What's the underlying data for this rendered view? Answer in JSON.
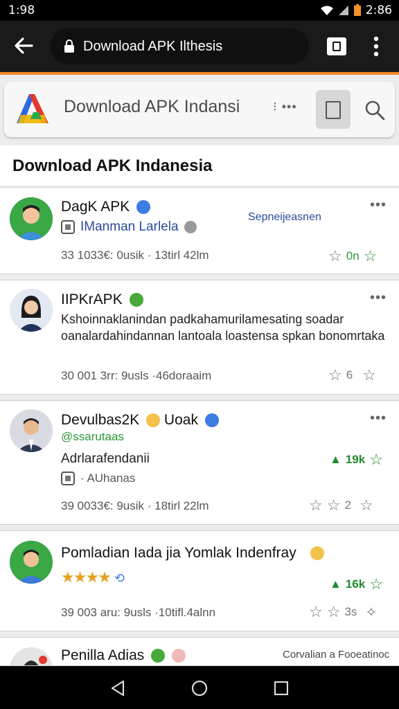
{
  "status": {
    "time_left": "1:98",
    "time_right": "2:86"
  },
  "browser": {
    "url": "Download APK Ilthesis"
  },
  "site": {
    "title": "Download APK Indansi",
    "dots": "⁝ •••"
  },
  "page": {
    "heading": "Download APK Indanesia"
  },
  "posts": [
    {
      "name": "DagK APK",
      "subtitle": "IManman Larlela",
      "tag": "Sepneijeasnen",
      "meta": "33 1033€: 0usik · 13tirl 42lm",
      "stat": "0n"
    },
    {
      "name": "IIPKrAPK",
      "text": "Kshoinnaklanindan padkahamurilamesating soadar oanalardahindannan lantoala loastensa spkan bonomrtaka",
      "meta": "30 001 3rr: 9usls ·46doraaim",
      "stat": "6"
    },
    {
      "name": "Devulbas2K",
      "name_suffix": "Uoak",
      "handle": "@ssarutaas",
      "text": "Adrlarafendanii",
      "source": "· AUhanas",
      "meta": "39 0033€: 9usik · 18tirl 22lm",
      "stat": "19k",
      "stat2": "2"
    },
    {
      "name": "Pomladian Iada jia Yomlak Indenfray",
      "meta": "39 003 aru: 9usls ·10tifl.4alnn",
      "stat": "16k",
      "stat2": "3s"
    },
    {
      "name": "Penilla Adias",
      "tag": "Corvalian a Fooeatinoc"
    }
  ]
}
